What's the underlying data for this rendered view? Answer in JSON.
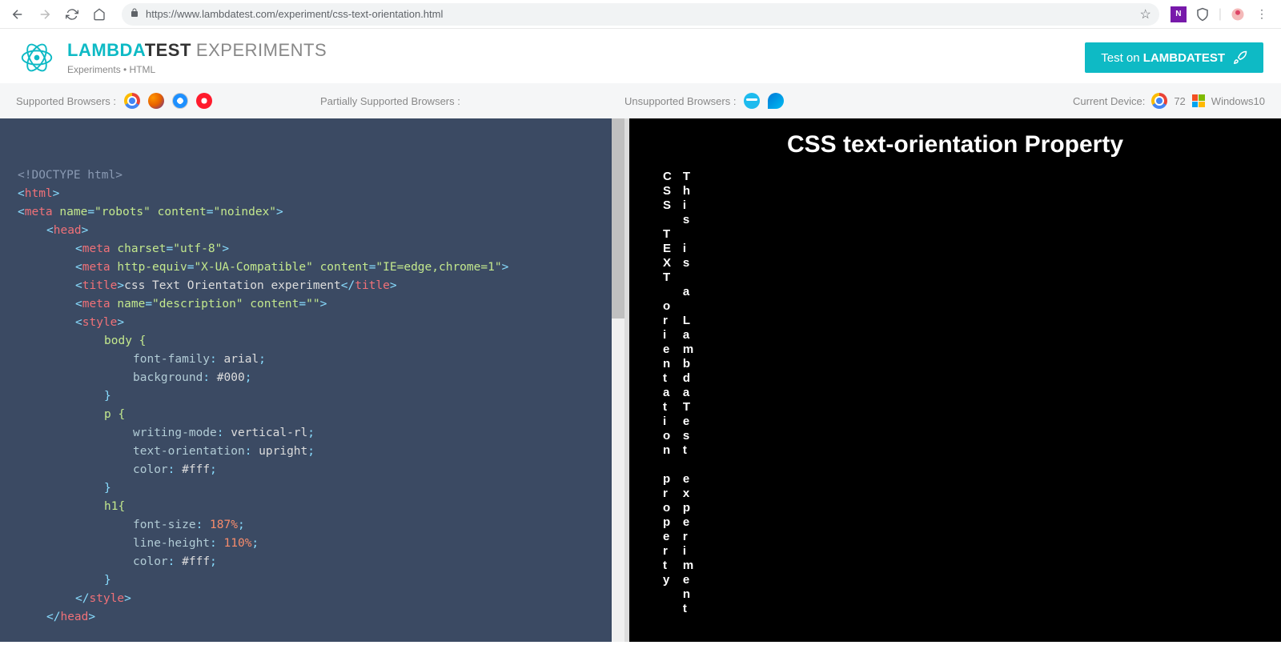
{
  "browser": {
    "url": "https://www.lambdatest.com/experiment/css-text-orientation.html"
  },
  "header": {
    "logo_lambda": "LAMBDA",
    "logo_test": "TEST",
    "logo_experiments": "EXPERIMENTS",
    "breadcrumb": "Experiments • HTML",
    "test_on": "Test on ",
    "test_brand": "LAMBDATEST"
  },
  "support": {
    "supported_label": "Supported Browsers :",
    "partial_label": "Partially Supported Browsers :",
    "unsupported_label": "Unsupported Browsers :",
    "device_label": "Current Device:",
    "chrome_version": "72",
    "os": "Windows10"
  },
  "code": {
    "l1": "<!DOCTYPE html>",
    "l2_open": "<",
    "l2_tag": "html",
    "l2_close": ">",
    "l3_open": "<",
    "l3_tag": "meta",
    "l3_attr1": "name",
    "l3_val1": "\"robots\"",
    "l3_attr2": "content",
    "l3_val2": "\"noindex\"",
    "l3_close": ">",
    "l4_open": "<",
    "l4_tag": "head",
    "l4_close": ">",
    "l5_open": "<",
    "l5_tag": "meta",
    "l5_attr": "charset",
    "l5_val": "\"utf-8\"",
    "l5_close": ">",
    "l6_open": "<",
    "l6_tag": "meta",
    "l6_attr1": "http-equiv",
    "l6_val1": "\"X-UA-Compatible\"",
    "l6_attr2": "content",
    "l6_val2": "\"IE=edge,chrome=1\"",
    "l6_close": ">",
    "l7_open": "<",
    "l7_tag": "title",
    "l7_text": "css Text Orientation experiment",
    "l7_open2": "</",
    "l7_close": ">",
    "l8_open": "<",
    "l8_tag": "meta",
    "l8_attr1": "name",
    "l8_val1": "\"description\"",
    "l8_attr2": "content",
    "l8_val2": "\"\"",
    "l8_close": ">",
    "l9_open": "<",
    "l9_tag": "style",
    "l9_close": ">",
    "l10": "body {",
    "l11_prop": "font-family",
    "l11_val": "arial",
    "l12_prop": "background",
    "l12_val": "#000",
    "l13": "}",
    "l14": "p {",
    "l15_prop": "writing-mode",
    "l15_val": "vertical-rl",
    "l16_prop": "text-orientation",
    "l16_val": "upright",
    "l17_prop": "color",
    "l17_val": "#fff",
    "l18": "}",
    "l19": "h1{",
    "l20_prop": "font-size",
    "l20_val": "187%",
    "l21_prop": "line-height",
    "l21_val": "110%",
    "l22_prop": "color",
    "l22_val": "#fff",
    "l23": "}",
    "l24_open": "</",
    "l24_tag": "style",
    "l24_close": ">",
    "l25_open": "</",
    "l25_tag": "head",
    "l25_close": ">"
  },
  "preview": {
    "heading": "CSS text-orientation Property",
    "col1_word1": "CSS",
    "col1_word2": "TEXT",
    "col1_word3": "orientation",
    "col1_word4": "property",
    "col2_word1": "This",
    "col2_word2": "is",
    "col2_word3": "a",
    "col2_word4": "LambdaTest",
    "col2_word5": "experiment"
  }
}
